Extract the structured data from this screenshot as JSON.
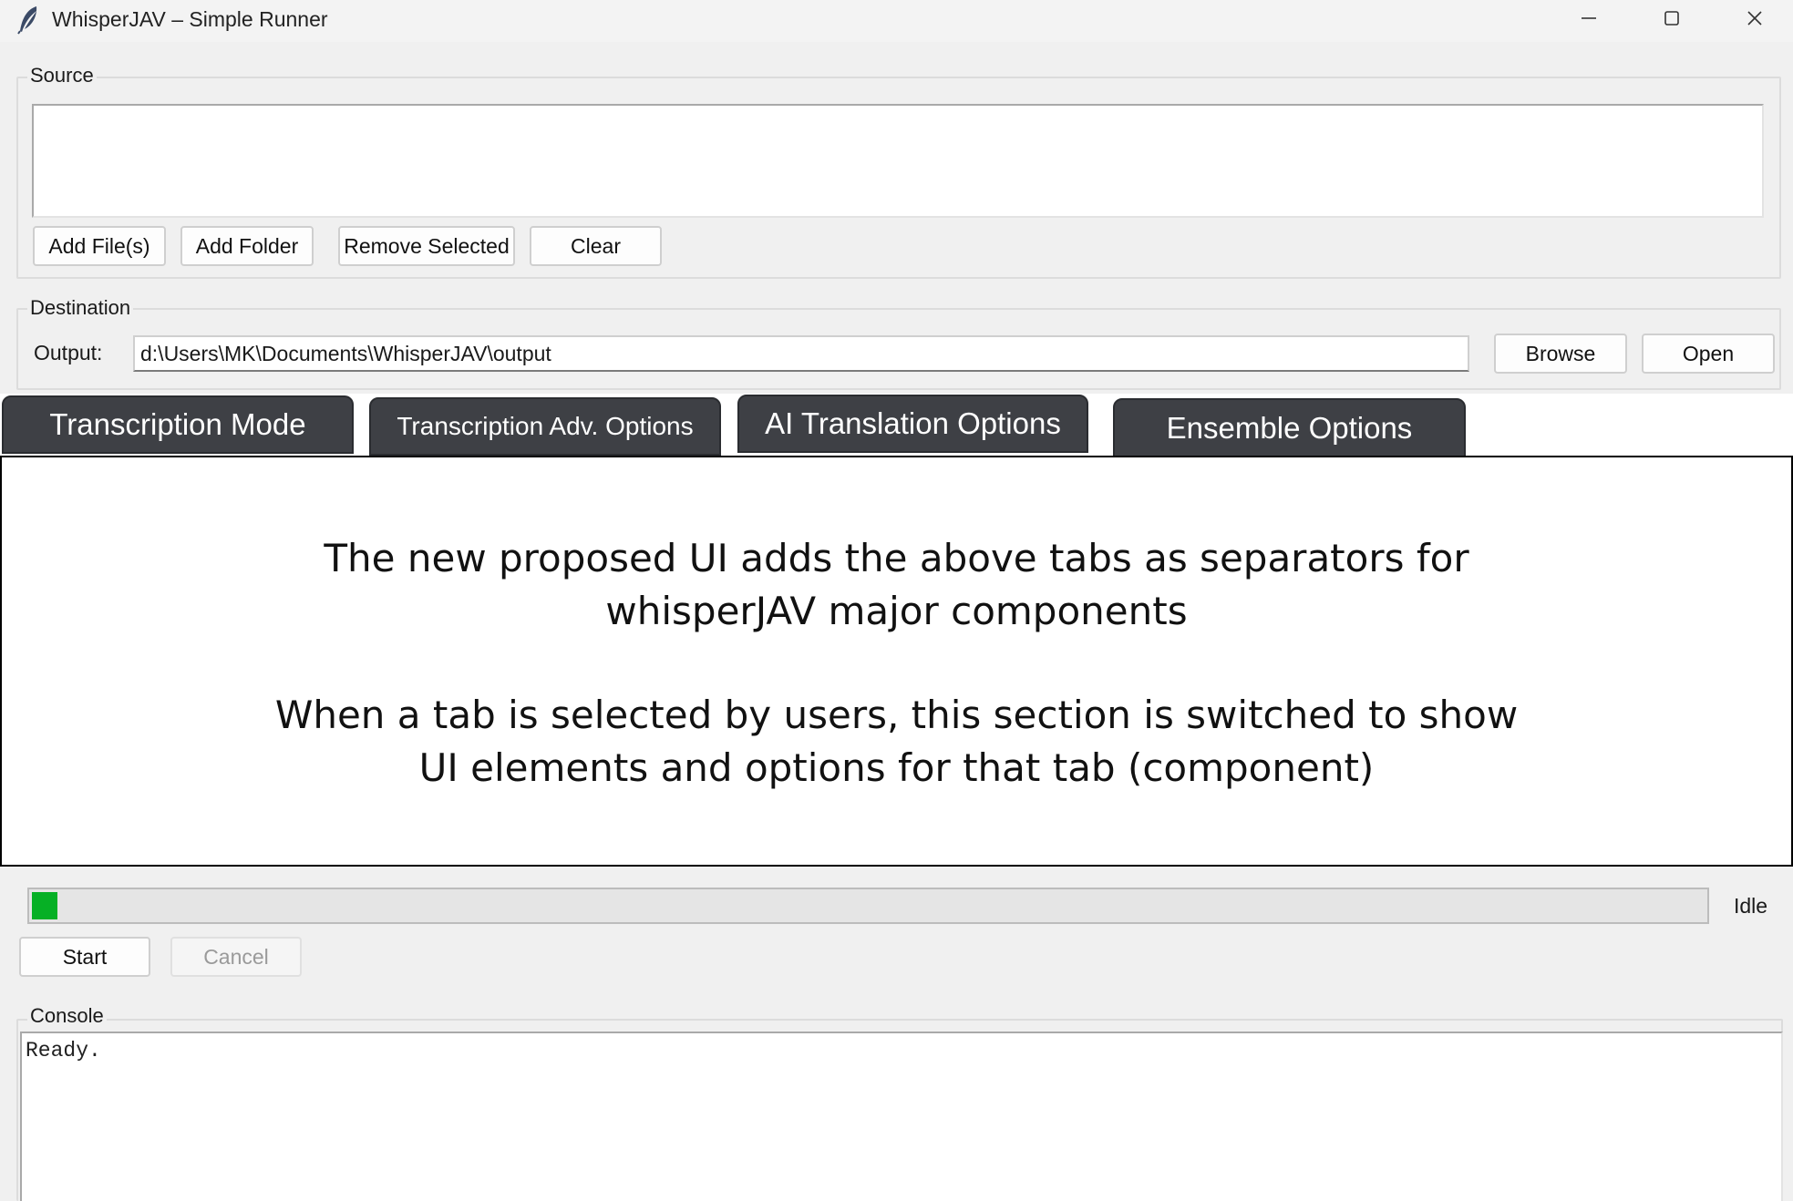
{
  "window": {
    "title": "WhisperJAV – Simple Runner",
    "icon": "feather-icon",
    "controls": [
      "minimize-icon",
      "maximize-icon",
      "close-icon"
    ]
  },
  "source": {
    "label": "Source",
    "files": [],
    "buttons": {
      "add_files": "Add File(s)",
      "add_folder": "Add Folder",
      "remove_selected": "Remove Selected",
      "clear": "Clear"
    }
  },
  "destination": {
    "label": "Destination",
    "output_label": "Output:",
    "output_value": "d:\\Users\\MK\\Documents\\WhisperJAV\\output",
    "browse": "Browse",
    "open": "Open"
  },
  "tabs": [
    {
      "label": "Transcription Mode"
    },
    {
      "label": "Transcription Adv. Options"
    },
    {
      "label": "AI Translation Options"
    },
    {
      "label": "Ensemble Options"
    }
  ],
  "tab_content": {
    "line1": "The new proposed UI adds the above tabs as separators for",
    "line2": "whisperJAV major components",
    "line3": "When a tab is selected by users, this section is switched to show",
    "line4": "UI elements and options for that tab (component)"
  },
  "progress": {
    "value_percent": 1.5,
    "status": "Idle",
    "fill_color": "#06b025"
  },
  "actions": {
    "start": "Start",
    "cancel": "Cancel"
  },
  "console": {
    "label": "Console",
    "text": "Ready."
  },
  "colors": {
    "tab_background": "#3e4045",
    "window_background": "#f0f0f0"
  }
}
